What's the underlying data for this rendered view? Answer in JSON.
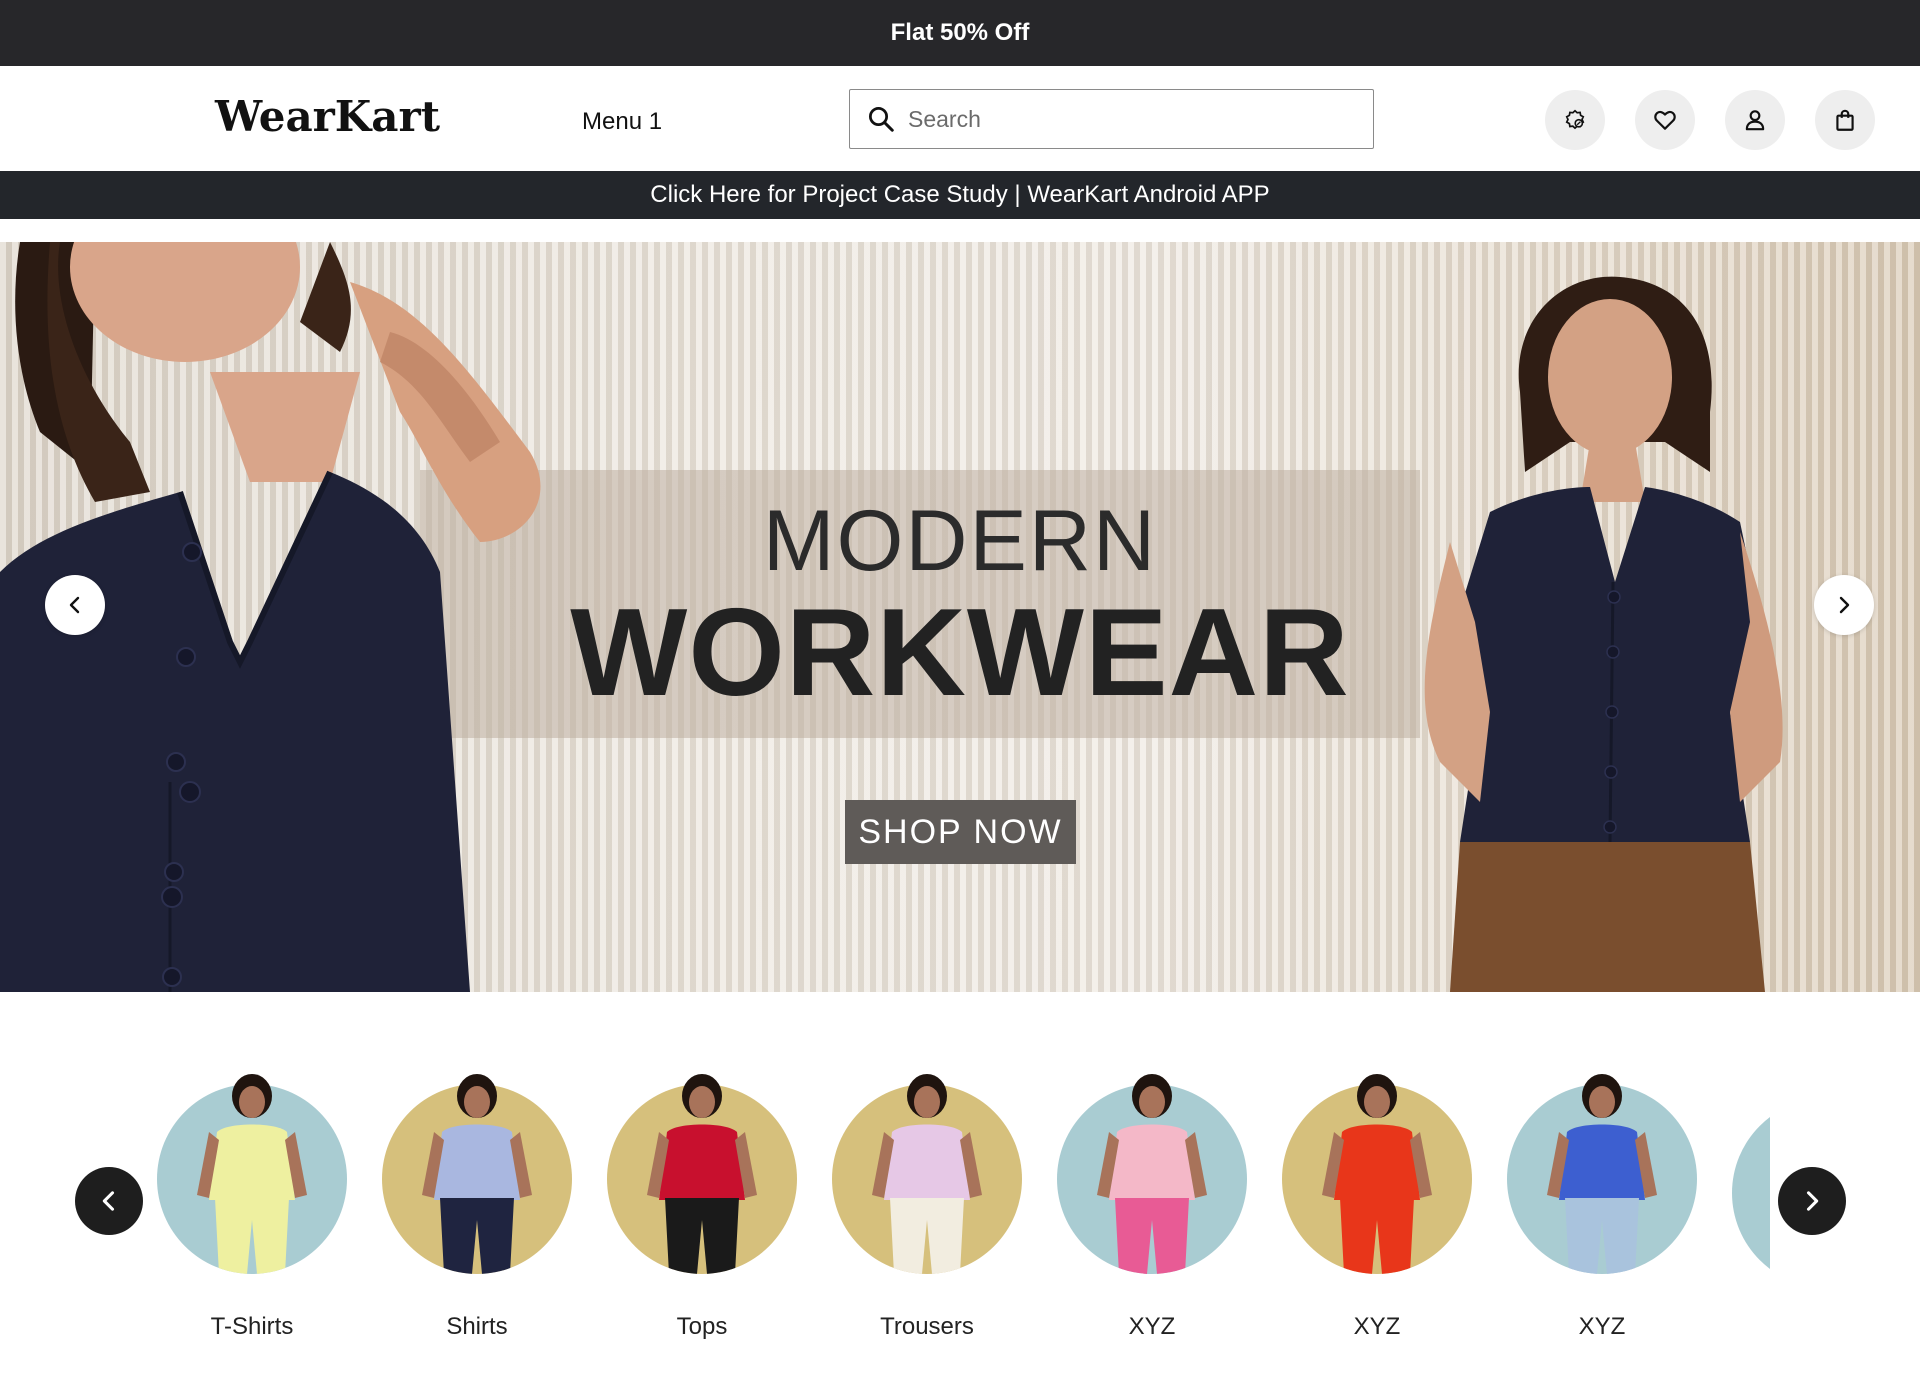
{
  "promo": {
    "text": "Flat 50% Off"
  },
  "header": {
    "logo": "WearKart",
    "menu_label": "Menu 1",
    "search": {
      "placeholder": "Search",
      "value": ""
    },
    "icons": [
      "coupon-icon",
      "heart-icon",
      "user-icon",
      "shopping-bag-icon"
    ]
  },
  "case_study": {
    "text": "Click Here for Project Case Study | WearKart Android APP"
  },
  "hero": {
    "title_line1": "MODERN",
    "title_line2": "WORKWEAR",
    "cta": "SHOP NOW"
  },
  "categories": [
    {
      "label": "T-Shirts",
      "bg": "#a9ccd2",
      "top": "#eef0a0",
      "bottom": "#eef0a0"
    },
    {
      "label": "Shirts",
      "bg": "#d6c07c",
      "top": "#a9b7e0",
      "bottom": "#1f2440"
    },
    {
      "label": "Tops",
      "bg": "#d6c07c",
      "top": "#c8102e",
      "bottom": "#1a1a1a"
    },
    {
      "label": "Trousers",
      "bg": "#d6c07c",
      "top": "#e6c8e6",
      "bottom": "#f2ede0"
    },
    {
      "label": "XYZ",
      "bg": "#a9ccd2",
      "top": "#f4b8c8",
      "bottom": "#e85b95"
    },
    {
      "label": "XYZ",
      "bg": "#d6c07c",
      "top": "#e8361a",
      "bottom": "#e8361a"
    },
    {
      "label": "XYZ",
      "bg": "#a9ccd2",
      "top": "#3d5fd0",
      "bottom": "#a9c3dd"
    }
  ],
  "colors": {
    "promo_bg": "#27272a",
    "case_study_bg": "#23262b",
    "cta_bg": "#5f5b58",
    "vest": "#1f2238"
  }
}
